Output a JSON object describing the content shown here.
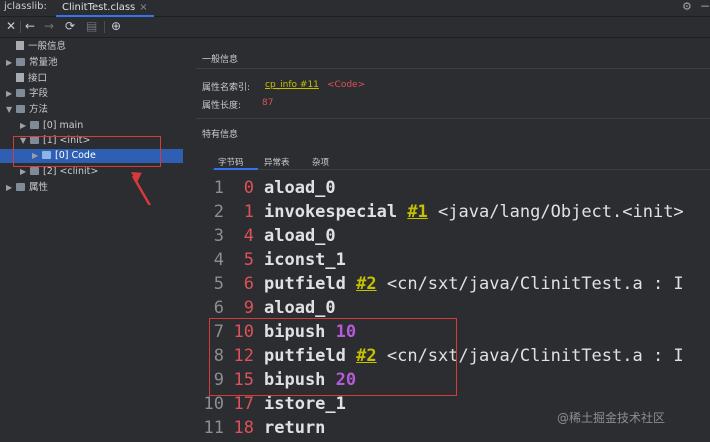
{
  "tabbar": {
    "app_title": "jclasslib:",
    "file_tab": "ClinitTest.class",
    "close_glyph": "×",
    "settings_glyph": "⚙",
    "minimize_glyph": "−"
  },
  "toolbar": {
    "close": "✕",
    "back": "←",
    "forward": "→",
    "reload": "⟳",
    "save": "▤",
    "browser": "⊕"
  },
  "tree": {
    "general": "一般信息",
    "constants": "常量池",
    "interfaces": "接口",
    "fields": "字段",
    "methods": "方法",
    "method_main": "[0] main",
    "method_init": "[1] <init>",
    "code_node": "[0] Code",
    "method_clinit": "[2] <clinit>",
    "attributes": "属性"
  },
  "detail": {
    "general_header": "一般信息",
    "name_index_label": "属性名索引:",
    "name_index_link": "cp_info #11",
    "name_index_value": "<Code>",
    "length_label": "属性长度:",
    "length_value": "87",
    "specific_header": "特有信息",
    "tabs": [
      "字节码",
      "异常表",
      "杂项"
    ]
  },
  "bytecode": [
    {
      "line": "1",
      "offset": "0",
      "op": "aload_0",
      "ref": "",
      "num": "",
      "arg": ""
    },
    {
      "line": "2",
      "offset": "1",
      "op": "invokespecial",
      "ref": "#1",
      "num": "",
      "arg": " <java/lang/Object.<init>"
    },
    {
      "line": "3",
      "offset": "4",
      "op": "aload_0",
      "ref": "",
      "num": "",
      "arg": ""
    },
    {
      "line": "4",
      "offset": "5",
      "op": "iconst_1",
      "ref": "",
      "num": "",
      "arg": ""
    },
    {
      "line": "5",
      "offset": "6",
      "op": "putfield",
      "ref": "#2",
      "num": "",
      "arg": " <cn/sxt/java/ClinitTest.a : I"
    },
    {
      "line": "6",
      "offset": "9",
      "op": "aload_0",
      "ref": "",
      "num": "",
      "arg": ""
    },
    {
      "line": "7",
      "offset": "10",
      "op": "bipush",
      "ref": "",
      "num": "10",
      "arg": ""
    },
    {
      "line": "8",
      "offset": "12",
      "op": "putfield",
      "ref": "#2",
      "num": "",
      "arg": " <cn/sxt/java/ClinitTest.a : I"
    },
    {
      "line": "9",
      "offset": "15",
      "op": "bipush",
      "ref": "",
      "num": "20",
      "arg": ""
    },
    {
      "line": "10",
      "offset": "17",
      "op": "istore_1",
      "ref": "",
      "num": "",
      "arg": ""
    },
    {
      "line": "11",
      "offset": "18",
      "op": "return",
      "ref": "",
      "num": "",
      "arg": ""
    }
  ],
  "watermark": "@稀土掘金技术社区",
  "colors": {
    "background": "#2b2d30",
    "selection": "#2e5fb3",
    "highlight_box": "#d63a3a",
    "link": "#c7c000",
    "offset": "#e0505a",
    "number": "#b55ad8"
  }
}
